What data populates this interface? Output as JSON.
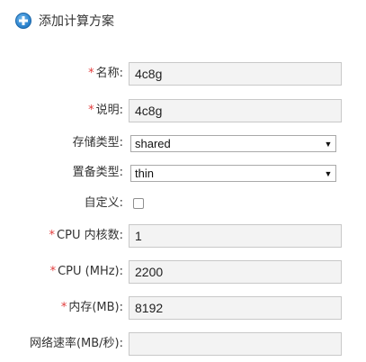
{
  "header": {
    "title": "添加计算方案",
    "icon": "add-circle-icon"
  },
  "form": {
    "name": {
      "label": "名称:",
      "value": "4c8g",
      "required": true
    },
    "description": {
      "label": "说明:",
      "value": "4c8g",
      "required": true
    },
    "storage_type": {
      "label": "存储类型:",
      "value": "shared"
    },
    "provisioning_type": {
      "label": "置备类型:",
      "value": "thin"
    },
    "custom": {
      "label": "自定义:",
      "checked": false
    },
    "cpu_cores": {
      "label": "CPU 内核数:",
      "value": "1",
      "required": true
    },
    "cpu_mhz": {
      "label": "CPU (MHz):",
      "value": "2200",
      "required": true
    },
    "memory_mb": {
      "label": "内存(MB):",
      "value": "8192",
      "required": true
    },
    "network_rate": {
      "label": "网络速率(MB/秒):",
      "value": ""
    }
  },
  "colors": {
    "required_star": "#e23c3c",
    "icon_blue": "#2f86d0"
  }
}
